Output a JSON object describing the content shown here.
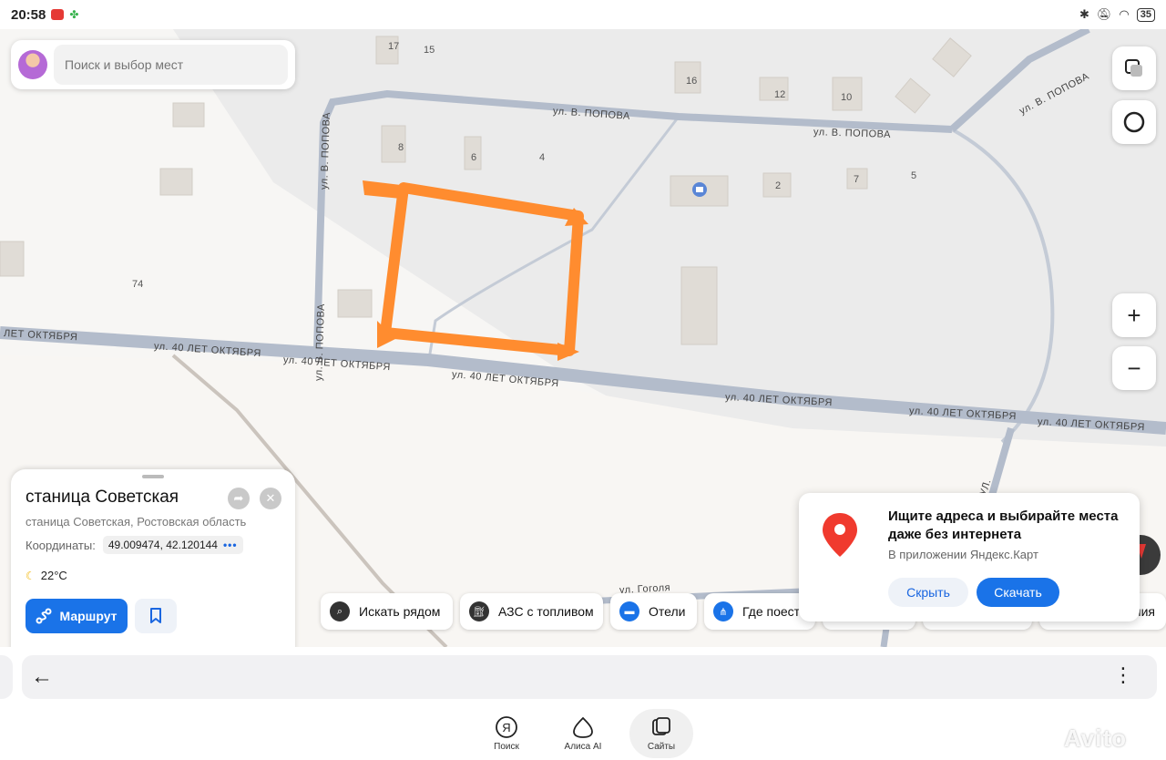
{
  "status_bar": {
    "time": "20:58",
    "battery": "35"
  },
  "search": {
    "placeholder": "Поиск и выбор мест"
  },
  "map": {
    "street_labels": {
      "popova_top_1": "ул. В. ПОПОВА",
      "popova_top_2": "ул. В. ПОПОВА",
      "popova_vertical_1": "ул. В. ПОПОВА",
      "popova_vertical_2": "ул. В. ПОПОВА",
      "popova_diagonal": "ул. В. ПОПОВА",
      "oktyabrya_1": "ЛЕТ ОКТЯБРЯ",
      "oktyabrya_2": "ул. 40 ЛЕТ ОКТЯБРЯ",
      "oktyabrya_3": "ул. 40 ЛЕТ ОКТЯБРЯ",
      "oktyabrya_4": "ул. 40 ЛЕТ ОКТЯБРЯ",
      "oktyabrya_5": "ул. 40 ЛЕТ ОКТЯБРЯ",
      "oktyabrya_6": "ул. 40 ЛЕТ ОКТЯБРЯ",
      "oktyabrya_7": "ул. 40 ЛЕТ ОКТЯБРЯ",
      "side_street": "ЧНАЯ УЛ.",
      "gogolya": "ул. Гоголя"
    },
    "house_numbers": {
      "n17": "17",
      "n15": "15",
      "n16": "16",
      "n12": "12",
      "n10": "10",
      "n8": "8",
      "n6": "6",
      "n4": "4",
      "n2": "2",
      "n7": "7",
      "n5": "5",
      "n74": "74"
    },
    "parcel_color": "#ff8c2f"
  },
  "controls": {
    "zoom_in": "+",
    "zoom_out": "−"
  },
  "place_card": {
    "title": "станица Советская",
    "subtitle": "станица Советская, Ростовская область",
    "coords_label": "Координаты:",
    "coords_value": "49.009474, 42.120144",
    "coords_more": "•••",
    "temperature": "22°C",
    "route_label": "Маршрут"
  },
  "chips": [
    {
      "label": "Искать рядом"
    },
    {
      "label": "АЗС с топливом"
    },
    {
      "label": "Отели"
    },
    {
      "label": "Где поест"
    },
    {
      "label": "ния"
    }
  ],
  "promo": {
    "title": "Ищите адреса и выбирайте места даже без интернета",
    "subtitle": "В приложении Яндекс.Карт",
    "hide_label": "Скрыть",
    "download_label": "Скачать"
  },
  "browser": {
    "back_icon": "←",
    "menu_icon": "⋮"
  },
  "bottom_nav": {
    "items": [
      {
        "label": "Поиск"
      },
      {
        "label": "Алиса AI"
      },
      {
        "label": "Сайты"
      }
    ]
  },
  "watermark": "Avito",
  "colors": {
    "accent": "#1a73e8",
    "road": "#b3bccb",
    "parcel": "#ff8c2f",
    "pin": "#f03a2e"
  }
}
